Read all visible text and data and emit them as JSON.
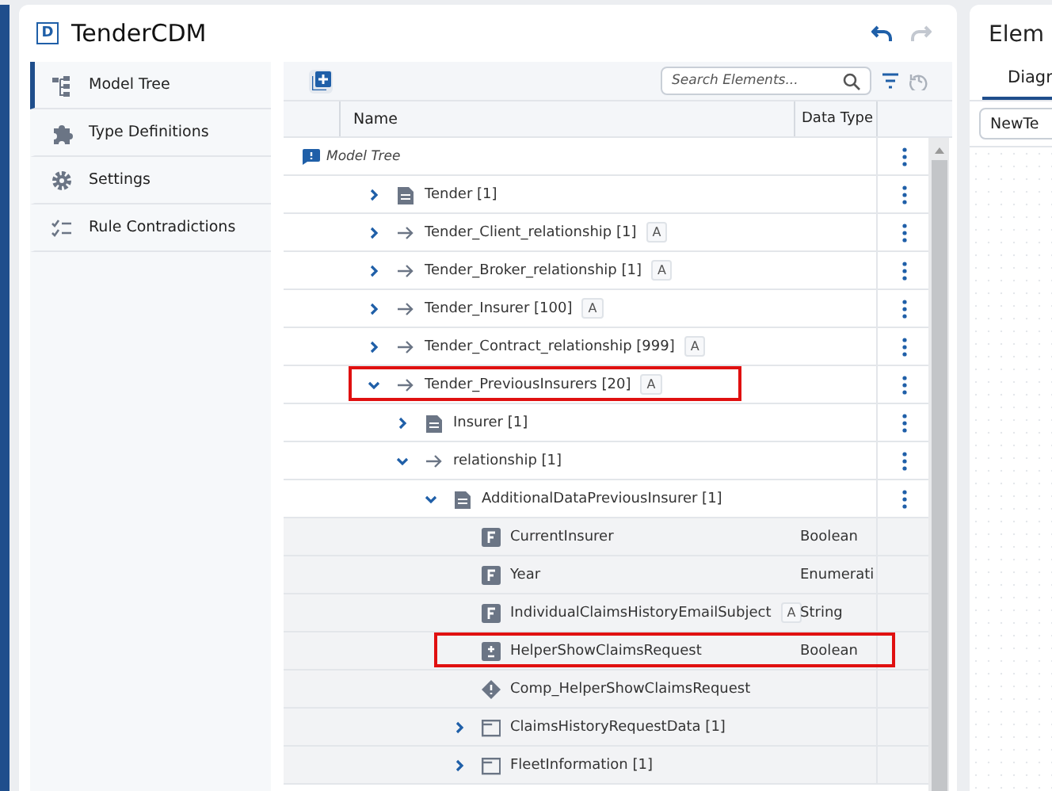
{
  "logo": "D",
  "title": "TenderCDM",
  "history": {
    "undo_disabled": false,
    "redo_disabled": true
  },
  "sidebar": {
    "items": [
      {
        "label": "Model Tree",
        "selected": true
      },
      {
        "label": "Type Definitions",
        "selected": false
      },
      {
        "label": "Settings",
        "selected": false
      },
      {
        "label": "Rule Contradictions",
        "selected": false
      }
    ]
  },
  "search": {
    "placeholder": "Search Elements..."
  },
  "table": {
    "columns": [
      "Name",
      "Data Type"
    ],
    "root": {
      "label": "Model Tree"
    },
    "tree": [
      {
        "label": "Tender [1]",
        "kind": "class",
        "expanded": false,
        "highlighted": false
      },
      {
        "label": "Tender_Client_relationship [1]",
        "kind": "relation",
        "expanded": false,
        "badge": "A",
        "highlighted": false
      },
      {
        "label": "Tender_Broker_relationship [1]",
        "kind": "relation",
        "expanded": false,
        "badge": "A",
        "highlighted": false
      },
      {
        "label": "Tender_Insurer [100]",
        "kind": "relation",
        "expanded": false,
        "badge": "A",
        "highlighted": false
      },
      {
        "label": "Tender_Contract_relationship [999]",
        "kind": "relation",
        "expanded": false,
        "badge": "A",
        "highlighted": false
      },
      {
        "label": "Tender_PreviousInsurers [20]",
        "kind": "relation",
        "expanded": true,
        "badge": "A",
        "highlighted": true,
        "children": [
          {
            "label": "Insurer [1]",
            "kind": "class",
            "expanded": false,
            "highlighted": false
          },
          {
            "label": "relationship [1]",
            "kind": "relation",
            "expanded": true,
            "highlighted": false,
            "children": [
              {
                "label": "AdditionalDataPreviousInsurer [1]",
                "kind": "class",
                "expanded": true,
                "highlighted": false,
                "children": [
                  {
                    "label": "CurrentInsurer",
                    "kind": "field",
                    "data_type": "Boolean",
                    "highlighted": false
                  },
                  {
                    "label": "Year",
                    "kind": "field",
                    "data_type": "Enumerati",
                    "highlighted": false
                  },
                  {
                    "label": "IndividualClaimsHistoryEmailSubject",
                    "kind": "field",
                    "badge": "A",
                    "data_type": "String",
                    "highlighted": false
                  },
                  {
                    "label": "HelperShowClaimsRequest",
                    "kind": "helper",
                    "data_type": "Boolean",
                    "highlighted": true
                  },
                  {
                    "label": "Comp_HelperShowClaimsRequest",
                    "kind": "rule",
                    "highlighted": false
                  },
                  {
                    "label": "ClaimsHistoryRequestData [1]",
                    "kind": "folder",
                    "expanded": false,
                    "highlighted": false
                  },
                  {
                    "label": "FleetInformation [1]",
                    "kind": "folder",
                    "expanded": false,
                    "highlighted": false
                  }
                ]
              }
            ]
          }
        ]
      }
    ]
  },
  "side_panel": {
    "title": "Elem",
    "tabs": [
      {
        "label": "Diagr",
        "selected": true
      }
    ],
    "select_value": "NewTe"
  }
}
